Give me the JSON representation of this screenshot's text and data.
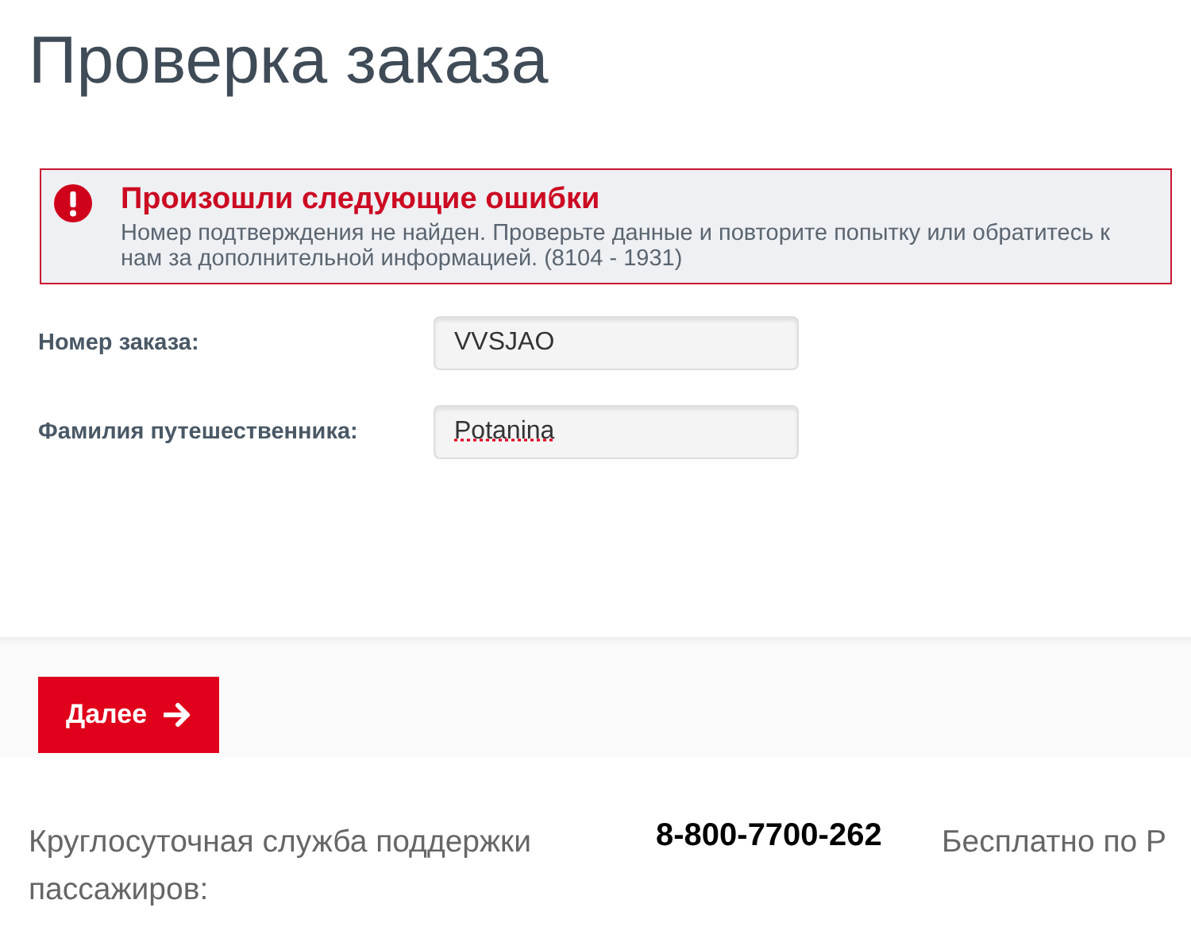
{
  "title": "Проверка заказа",
  "error": {
    "title": "Произошли следующие ошибки",
    "message": "Номер подтверждения не найден. Проверьте данные и повторите попытку или обратитесь к нам за дополнительной информацией. (8104 - 1931)"
  },
  "fields": [
    {
      "label": "Номер заказа:",
      "value": "VVSJAO",
      "spellcheck_error": false
    },
    {
      "label": "Фамилия путешественника:",
      "value": "Potanina",
      "spellcheck_error": true
    }
  ],
  "next_button": "Далее",
  "support": {
    "label": "Круглосуточная служба поддержки пассажиров:",
    "phone": "8-800-7700-262",
    "note": "Бесплатно по Р"
  }
}
